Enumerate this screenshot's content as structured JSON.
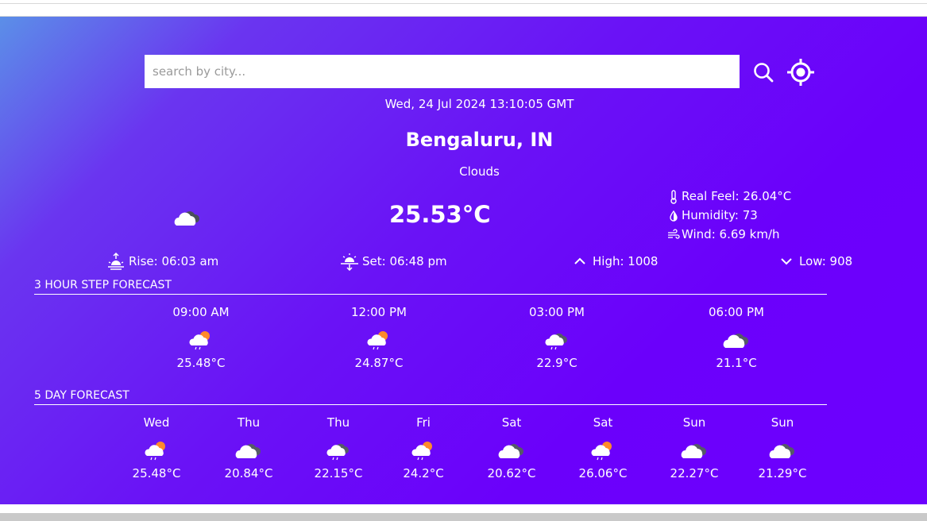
{
  "search": {
    "placeholder": "search by city..."
  },
  "current": {
    "date": "Wed, 24 Jul 2024 13:10:05 GMT",
    "city": "Bengaluru, IN",
    "condition": "Clouds",
    "temperature": "25.53°C",
    "icon": "cloud-icon",
    "real_feel": "Real Feel: 26.04°C",
    "humidity": "Humidity: 73",
    "wind": "Wind: 6.69 km/h",
    "rise": "Rise: 06:03 am",
    "set": "Set: 06:48 pm",
    "high": "High: 1008",
    "low": "Low: 908"
  },
  "hourly": {
    "title": "3 HOUR STEP FORECAST",
    "items": [
      {
        "label": "09:00 AM",
        "temp": "25.48°C",
        "icon": "sun-cloud-rain-icon"
      },
      {
        "label": "12:00 PM",
        "temp": "24.87°C",
        "icon": "sun-cloud-rain-icon"
      },
      {
        "label": "03:00 PM",
        "temp": "22.9°C",
        "icon": "cloud-rain-icon"
      },
      {
        "label": "06:00 PM",
        "temp": "21.1°C",
        "icon": "cloud-icon"
      }
    ]
  },
  "daily": {
    "title": "5 DAY FORECAST",
    "items": [
      {
        "label": "Wed",
        "temp": "25.48°C",
        "icon": "sun-cloud-rain-icon"
      },
      {
        "label": "Thu",
        "temp": "20.84°C",
        "icon": "cloud-icon"
      },
      {
        "label": "Thu",
        "temp": "22.15°C",
        "icon": "cloud-rain-icon"
      },
      {
        "label": "Fri",
        "temp": "24.2°C",
        "icon": "sun-cloud-rain-icon"
      },
      {
        "label": "Sat",
        "temp": "20.62°C",
        "icon": "cloud-icon"
      },
      {
        "label": "Sat",
        "temp": "26.06°C",
        "icon": "sun-cloud-rain-icon"
      },
      {
        "label": "Sun",
        "temp": "22.27°C",
        "icon": "cloud-icon"
      },
      {
        "label": "Sun",
        "temp": "21.29°C",
        "icon": "cloud-icon"
      }
    ]
  },
  "colors": {
    "gradient_start": "#5b8fe8",
    "gradient_end": "#6d00ff",
    "sun": "#ff8a2a",
    "cloud_front": "#ffffff",
    "cloud_back": "#555a66"
  }
}
